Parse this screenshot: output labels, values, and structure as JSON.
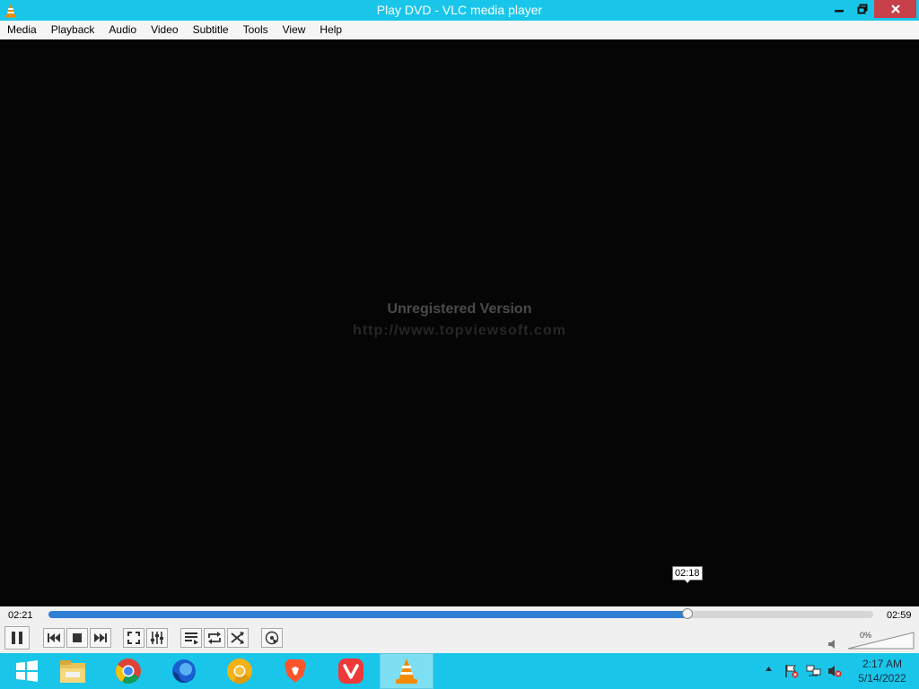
{
  "window": {
    "title": "Play DVD - VLC media player",
    "accent_color": "#19c6ea",
    "close_color": "#c7404a"
  },
  "menubar": {
    "items": [
      "Media",
      "Playback",
      "Audio",
      "Video",
      "Subtitle",
      "Tools",
      "View",
      "Help"
    ]
  },
  "video": {
    "watermark_line1": "Unregistered Version",
    "watermark_line2": "http://www.topviewsoft.com",
    "seek_tooltip": "02:18"
  },
  "controls": {
    "time_elapsed": "02:21",
    "time_total": "02:59",
    "seek_progress": 0.775,
    "volume_label": "0%",
    "volume_level": 0,
    "buttons": [
      "pause-icon",
      "previous-icon",
      "stop-icon",
      "next-icon",
      "fullscreen-icon",
      "extended-settings-icon",
      "playlist-icon",
      "loop-icon",
      "shuffle-icon",
      "frame-by-frame-icon"
    ]
  },
  "taskbar": {
    "apps": [
      "windows-start-icon",
      "file-explorer-icon",
      "chrome-icon",
      "firefox-icon",
      "chrome-canary-icon",
      "brave-icon",
      "vivaldi-icon",
      "vlc-icon"
    ],
    "clock_time": "2:17 AM",
    "clock_date": "5/14/2022"
  }
}
